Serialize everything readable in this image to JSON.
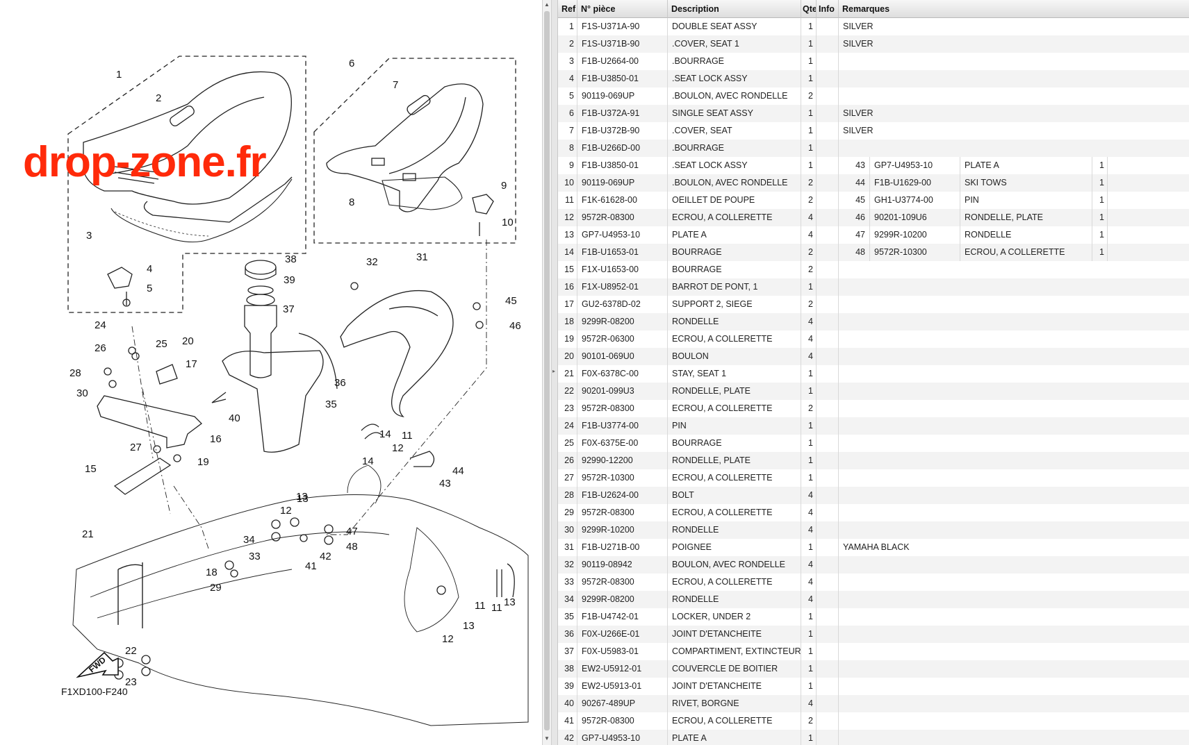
{
  "watermark": "drop-zone.fr",
  "figure_code": "F1XD100-F240",
  "fwd_label": "FWD",
  "callouts": [
    "1",
    "2",
    "3",
    "4",
    "5",
    "6",
    "7",
    "8",
    "9",
    "10",
    "11",
    "12",
    "13",
    "14",
    "15",
    "16",
    "17",
    "18",
    "19",
    "20",
    "21",
    "22",
    "23",
    "24",
    "25",
    "26",
    "27",
    "28",
    "29",
    "30",
    "31",
    "32",
    "33",
    "34",
    "35",
    "36",
    "37",
    "38",
    "39",
    "40",
    "41",
    "42",
    "43",
    "44",
    "45",
    "46",
    "47",
    "48",
    "11",
    "12",
    "13",
    "14",
    "12",
    "13",
    "13",
    "11",
    "14"
  ],
  "table": {
    "headers": {
      "ref": "Ref",
      "part_no": "N° pièce",
      "description": "Description",
      "qty": "Qte",
      "info": "Info",
      "remarks": "Remarques"
    },
    "rows": [
      {
        "ref": "1",
        "pn": "F1S-U371A-90",
        "desc": "DOUBLE SEAT ASSY",
        "qty": "1",
        "rem": "SILVER"
      },
      {
        "ref": "2",
        "pn": "F1S-U371B-90",
        "desc": ".COVER, SEAT 1",
        "qty": "1",
        "rem": "SILVER"
      },
      {
        "ref": "3",
        "pn": "F1B-U2664-00",
        "desc": ".BOURRAGE",
        "qty": "1",
        "rem": ""
      },
      {
        "ref": "4",
        "pn": "F1B-U3850-01",
        "desc": ".SEAT LOCK ASSY",
        "qty": "1",
        "rem": ""
      },
      {
        "ref": "5",
        "pn": "90119-069UP",
        "desc": ".BOULON, AVEC RONDELLE",
        "qty": "2",
        "rem": ""
      },
      {
        "ref": "6",
        "pn": "F1B-U372A-91",
        "desc": "SINGLE SEAT ASSY",
        "qty": "1",
        "rem": "SILVER"
      },
      {
        "ref": "7",
        "pn": "F1B-U372B-90",
        "desc": ".COVER, SEAT",
        "qty": "1",
        "rem": "SILVER"
      },
      {
        "ref": "8",
        "pn": "F1B-U266D-00",
        "desc": ".BOURRAGE",
        "qty": "1",
        "rem": ""
      },
      {
        "ref": "9",
        "pn": "F1B-U3850-01",
        "desc": ".SEAT LOCK ASSY",
        "qty": "1",
        "rem": ""
      },
      {
        "ref": "10",
        "pn": "90119-069UP",
        "desc": ".BOULON, AVEC RONDELLE",
        "qty": "2",
        "rem": ""
      },
      {
        "ref": "11",
        "pn": "F1K-61628-00",
        "desc": "OEILLET DE POUPE",
        "qty": "2",
        "rem": ""
      },
      {
        "ref": "12",
        "pn": "9572R-08300",
        "desc": "ECROU, A COLLERETTE",
        "qty": "4",
        "rem": ""
      },
      {
        "ref": "13",
        "pn": "GP7-U4953-10",
        "desc": "PLATE A",
        "qty": "4",
        "rem": ""
      },
      {
        "ref": "14",
        "pn": "F1B-U1653-01",
        "desc": "BOURRAGE",
        "qty": "2",
        "rem": ""
      },
      {
        "ref": "15",
        "pn": "F1X-U1653-00",
        "desc": "BOURRAGE",
        "qty": "2",
        "rem": ""
      },
      {
        "ref": "16",
        "pn": "F1X-U8952-01",
        "desc": "BARROT DE PONT, 1",
        "qty": "1",
        "rem": ""
      },
      {
        "ref": "17",
        "pn": "GU2-6378D-02",
        "desc": "SUPPORT 2, SIEGE",
        "qty": "2",
        "rem": ""
      },
      {
        "ref": "18",
        "pn": "9299R-08200",
        "desc": "RONDELLE",
        "qty": "4",
        "rem": ""
      },
      {
        "ref": "19",
        "pn": "9572R-06300",
        "desc": "ECROU, A COLLERETTE",
        "qty": "4",
        "rem": ""
      },
      {
        "ref": "20",
        "pn": "90101-069U0",
        "desc": "BOULON",
        "qty": "4",
        "rem": ""
      },
      {
        "ref": "21",
        "pn": "F0X-6378C-00",
        "desc": "STAY, SEAT 1",
        "qty": "1",
        "rem": ""
      },
      {
        "ref": "22",
        "pn": "90201-099U3",
        "desc": "RONDELLE, PLATE",
        "qty": "1",
        "rem": ""
      },
      {
        "ref": "23",
        "pn": "9572R-08300",
        "desc": "ECROU, A COLLERETTE",
        "qty": "2",
        "rem": ""
      },
      {
        "ref": "24",
        "pn": "F1B-U3774-00",
        "desc": "PIN",
        "qty": "1",
        "rem": ""
      },
      {
        "ref": "25",
        "pn": "F0X-6375E-00",
        "desc": "BOURRAGE",
        "qty": "1",
        "rem": ""
      },
      {
        "ref": "26",
        "pn": "92990-12200",
        "desc": "RONDELLE, PLATE",
        "qty": "1",
        "rem": ""
      },
      {
        "ref": "27",
        "pn": "9572R-10300",
        "desc": "ECROU, A COLLERETTE",
        "qty": "1",
        "rem": ""
      },
      {
        "ref": "28",
        "pn": "F1B-U2624-00",
        "desc": "BOLT",
        "qty": "4",
        "rem": ""
      },
      {
        "ref": "29",
        "pn": "9572R-08300",
        "desc": "ECROU, A COLLERETTE",
        "qty": "4",
        "rem": ""
      },
      {
        "ref": "30",
        "pn": "9299R-10200",
        "desc": "RONDELLE",
        "qty": "4",
        "rem": ""
      },
      {
        "ref": "31",
        "pn": "F1B-U271B-00",
        "desc": "POIGNEE",
        "qty": "1",
        "rem": "YAMAHA BLACK"
      },
      {
        "ref": "32",
        "pn": "90119-08942",
        "desc": "BOULON, AVEC RONDELLE",
        "qty": "4",
        "rem": ""
      },
      {
        "ref": "33",
        "pn": "9572R-08300",
        "desc": "ECROU, A COLLERETTE",
        "qty": "4",
        "rem": ""
      },
      {
        "ref": "34",
        "pn": "9299R-08200",
        "desc": "RONDELLE",
        "qty": "4",
        "rem": ""
      },
      {
        "ref": "35",
        "pn": "F1B-U4742-01",
        "desc": "LOCKER, UNDER 2",
        "qty": "1",
        "rem": ""
      },
      {
        "ref": "36",
        "pn": "F0X-U266E-01",
        "desc": "JOINT D'ETANCHEITE",
        "qty": "1",
        "rem": ""
      },
      {
        "ref": "37",
        "pn": "F0X-U5983-01",
        "desc": "COMPARTIMENT, EXTINCTEUR",
        "qty": "1",
        "rem": ""
      },
      {
        "ref": "38",
        "pn": "EW2-U5912-01",
        "desc": "COUVERCLE DE BOITIER",
        "qty": "1",
        "rem": ""
      },
      {
        "ref": "39",
        "pn": "EW2-U5913-01",
        "desc": "JOINT D'ETANCHEITE",
        "qty": "1",
        "rem": ""
      },
      {
        "ref": "40",
        "pn": "90267-489UP",
        "desc": "RIVET, BORGNE",
        "qty": "4",
        "rem": ""
      },
      {
        "ref": "41",
        "pn": "9572R-08300",
        "desc": "ECROU, A COLLERETTE",
        "qty": "2",
        "rem": ""
      },
      {
        "ref": "42",
        "pn": "GP7-U4953-10",
        "desc": "PLATE A",
        "qty": "1",
        "rem": ""
      }
    ],
    "extra_rows": [
      {
        "ref": "43",
        "pn": "GP7-U4953-10",
        "desc": "PLATE A",
        "qty": "1"
      },
      {
        "ref": "44",
        "pn": "F1B-U1629-00",
        "desc": "SKI TOWS",
        "qty": "1"
      },
      {
        "ref": "45",
        "pn": "GH1-U3774-00",
        "desc": "PIN",
        "qty": "1"
      },
      {
        "ref": "46",
        "pn": "90201-109U6",
        "desc": "RONDELLE, PLATE",
        "qty": "1"
      },
      {
        "ref": "47",
        "pn": "9299R-10200",
        "desc": "RONDELLE",
        "qty": "1"
      },
      {
        "ref": "48",
        "pn": "9572R-10300",
        "desc": "ECROU, A COLLERETTE",
        "qty": "1"
      }
    ]
  },
  "colors": {
    "watermark": "#ff2a0a",
    "row_alt": "#f3f3f3",
    "line": "#222222"
  }
}
